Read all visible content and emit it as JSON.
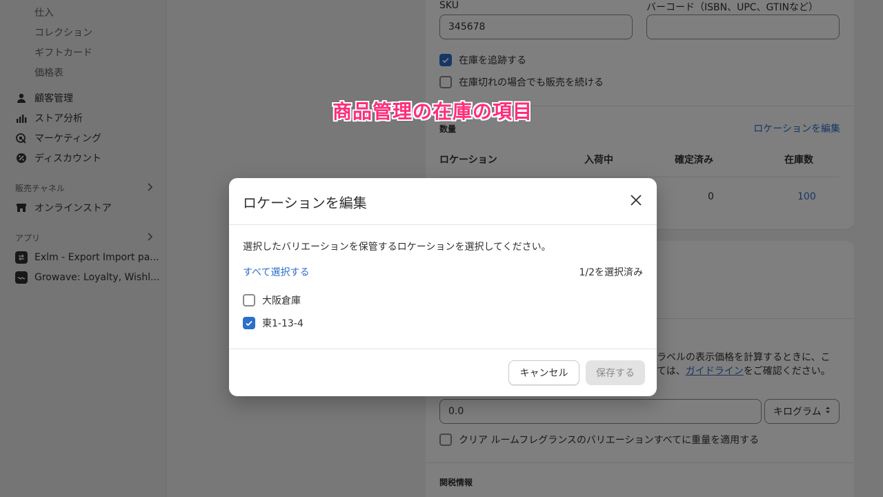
{
  "sidebar": {
    "sub_items": [
      "仕入",
      "コレクション",
      "ギフトカード",
      "価格表"
    ],
    "nav_items": [
      {
        "label": "顧客管理",
        "icon": "person-icon"
      },
      {
        "label": "ストア分析",
        "icon": "bar-chart-icon"
      },
      {
        "label": "マーケティング",
        "icon": "target-icon"
      },
      {
        "label": "ディスカウント",
        "icon": "discount-icon"
      }
    ],
    "sales_channels": {
      "heading": "販売チャネル",
      "items": [
        "オンラインストア"
      ]
    },
    "apps": {
      "heading": "アプリ",
      "items": [
        "Exlm - Export Import pa...",
        "Growave: Loyalty, Wishl..."
      ]
    }
  },
  "product": {
    "sku_label": "SKU",
    "sku_value": "345678",
    "barcode_label": "バーコード（ISBN、UPC、GTINなど）",
    "barcode_value": "",
    "track_inventory_label": "在庫を追跡する",
    "continue_selling_label": "在庫切れの場合でも販売を続ける",
    "quantity_label": "数量",
    "edit_locations_link": "ロケーションを編集",
    "table_headers": [
      "ロケーション",
      "入荷中",
      "確定済み",
      "在庫数"
    ],
    "committed_value": "0",
    "available_value": "100",
    "shipping_desc_line1": "ラベルの表示価格を計算するときに、こ",
    "shipping_desc_line2_pre": "ては、",
    "guideline_link": "ガイドライン",
    "shipping_desc_line2_post": "をご確認ください。",
    "weight_value": "0.0",
    "weight_unit": "キログラム",
    "apply_weight_label": "クリア ルームフレグランスのバリエーションすべてに重量を適用する",
    "customs_label": "関税情報"
  },
  "annotation": "商品管理の在庫の項目",
  "modal": {
    "title": "ロケーションを編集",
    "description": "選択したバリエーションを保管するロケーションを選択してください。",
    "select_all": "すべて選択する",
    "selected_count": "1/2を選択済み",
    "locations": [
      {
        "name": "大阪倉庫",
        "checked": false
      },
      {
        "name": "東1-13-4",
        "checked": true
      }
    ],
    "cancel_label": "キャンセル",
    "save_label": "保存する"
  },
  "colors": {
    "accent": "#2c6ecb",
    "annotation": "#ff2d7a"
  }
}
